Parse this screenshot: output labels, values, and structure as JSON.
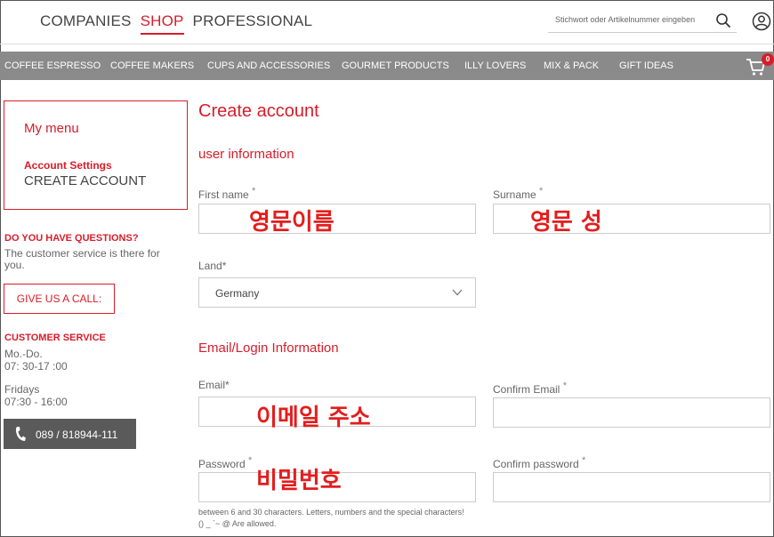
{
  "header": {
    "brand_tabs": [
      "COMPANIES",
      "SHOP",
      "PROFESSIONAL"
    ],
    "active_tab": "SHOP",
    "search_placeholder": "Stichwort oder Artikelnummer eingeben"
  },
  "categories": [
    "COFFEE ESPRESSO",
    "COFFEE MAKERS",
    "CUPS AND ACCESSORIES",
    "GOURMET PRODUCTS",
    "ILLY LOVERS",
    "MIX & PACK",
    "GIFT IDEAS"
  ],
  "cart": {
    "count": "0"
  },
  "sidebar": {
    "menu_title": "My menu",
    "menu_section": "Account Settings",
    "menu_item": "CREATE ACCOUNT",
    "questions_title": "DO YOU HAVE QUESTIONS?",
    "questions_text": "The customer service is there for you.",
    "call_button": "GIVE US A CALL:",
    "service_title": "CUSTOMER SERVICE",
    "hours_days_1": "Mo.-Do.",
    "hours_time_1": "07: 30-17 :00",
    "hours_days_2": "Fridays",
    "hours_time_2": "07:30 - 16:00",
    "phone": "089 / 818944-111"
  },
  "form": {
    "title": "Create account",
    "section_user": "user information",
    "first_name_label": "First name",
    "surname_label": "Surname",
    "land_label": "Land*",
    "land_value": "Germany",
    "section_login": "Email/Login Information",
    "email_label": "Email*",
    "confirm_email_label": "Confirm Email",
    "password_label": "Password",
    "confirm_password_label": "Confirm password",
    "password_hint": "between 6 and 30 characters. Letters, numbers and the special characters! () _ `~ @ Are allowed.",
    "required_mark": "*"
  },
  "annotations": {
    "first_name": "영문이름",
    "surname": "영문 성",
    "email": "이메일 주소",
    "password": "비밀번호"
  },
  "colors": {
    "accent": "#d71d2a",
    "category_bar": "#8a8a8a",
    "phone_button": "#5a5a5a",
    "annotation": "#e41d1d"
  }
}
